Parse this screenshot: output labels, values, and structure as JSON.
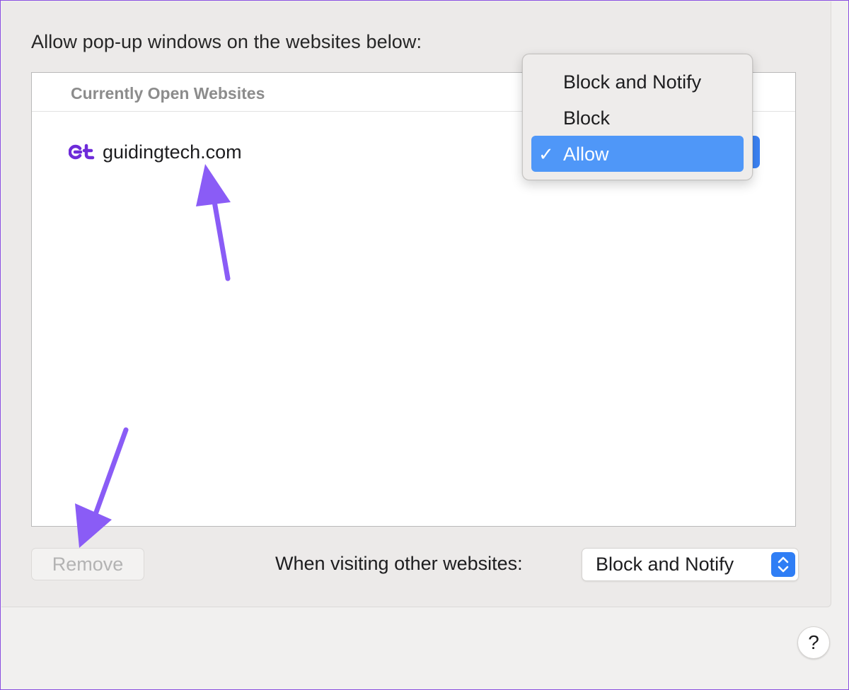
{
  "heading": "Allow pop-up windows on the websites below:",
  "list": {
    "header": "Currently Open Websites",
    "rows": [
      {
        "site": "guidingtech.com",
        "icon": "guidingtech-logo-icon"
      }
    ]
  },
  "dropdown_menu": {
    "options": [
      "Block and Notify",
      "Block",
      "Allow"
    ],
    "selected": "Allow",
    "check_mark": "✓"
  },
  "footer": {
    "remove_label": "Remove",
    "other_websites_label": "When visiting other websites:",
    "other_websites_value": "Block and Notify"
  },
  "help": {
    "label": "?"
  },
  "colors": {
    "accent": "#4f97f8",
    "annotation_arrow": "#8a4fe0",
    "logo_purple": "#6e2bd9"
  }
}
